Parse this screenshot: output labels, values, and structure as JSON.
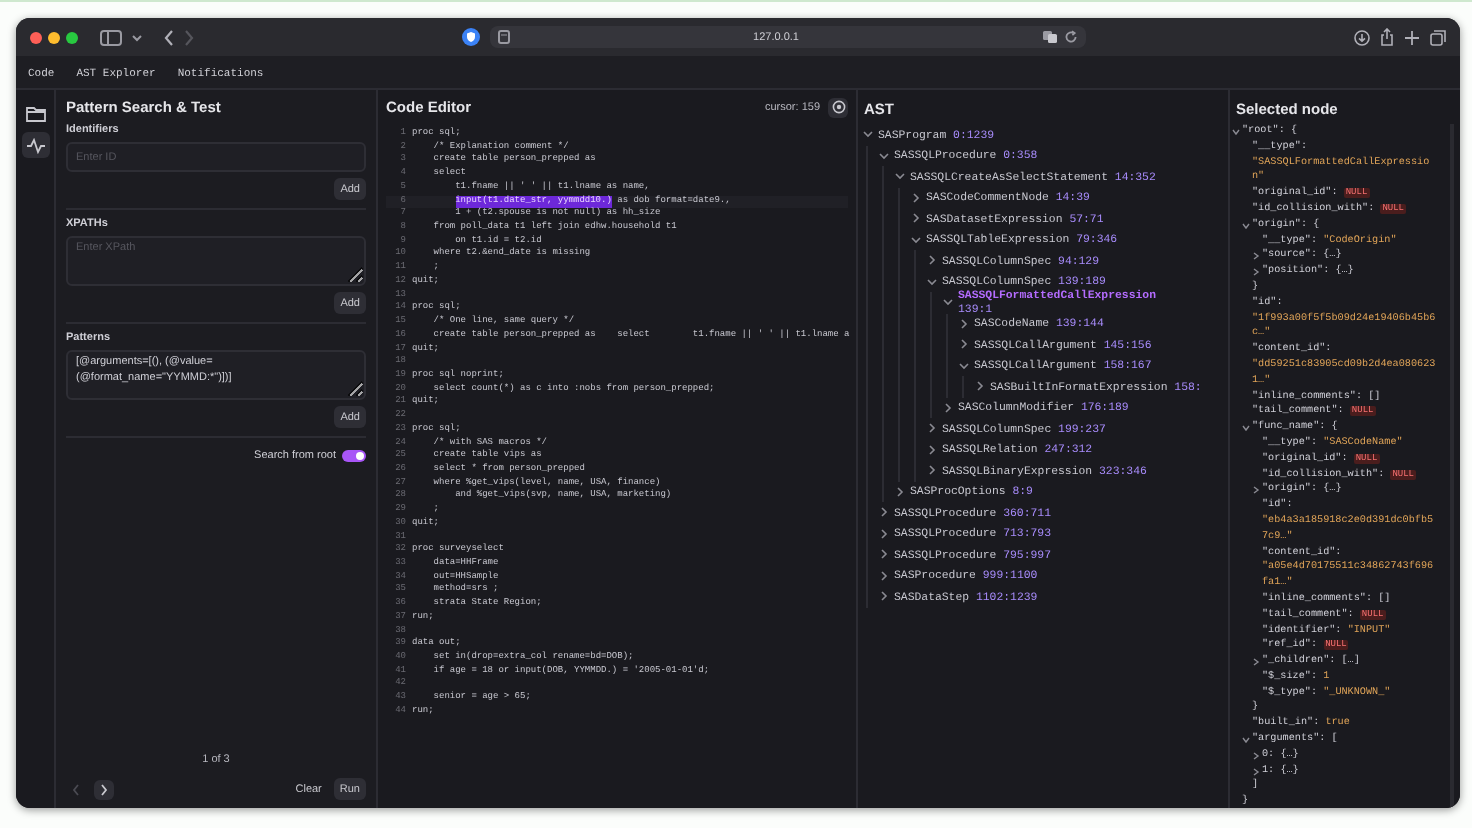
{
  "browser": {
    "url": "127.0.0.1"
  },
  "menu": [
    "Code",
    "AST Explorer",
    "Notifications"
  ],
  "rail": [
    {
      "kind": "folder",
      "selected": false
    },
    {
      "kind": "activity",
      "selected": true
    }
  ],
  "search": {
    "title": "Pattern Search & Test",
    "sections": [
      {
        "label": "Identifiers",
        "kind": "input",
        "placeholder": "Enter ID",
        "button": "Add"
      },
      {
        "label": "XPATHs",
        "kind": "textarea",
        "placeholder": "Enter XPath",
        "button": "Add"
      },
      {
        "label": "Patterns",
        "kind": "textarea",
        "value": "[@arguments=[(), (@value=(@format_name=\"YYMMD:*\")])]",
        "button": "Add"
      }
    ],
    "from_root": {
      "label": "Search from root",
      "on": true
    },
    "pager": "1 of 3",
    "prev_disabled": true,
    "next_disabled": false,
    "clear": "Clear",
    "run": "Run"
  },
  "editor": {
    "title": "Code Editor",
    "cursor": "cursor: 159",
    "lines": [
      {
        "n": "1",
        "text": "proc sql;"
      },
      {
        "n": "2",
        "text": "    /* Explanation comment */"
      },
      {
        "n": "3",
        "text": "    create table person_prepped as"
      },
      {
        "n": "4",
        "text": "    select"
      },
      {
        "n": "5",
        "text": "        t1.fname || ' ' || t1.lname as name,"
      },
      {
        "n": "6",
        "highlight": "input(t1.date_str, yymmdd10.)",
        "after": " as dob format=date9.,"
      },
      {
        "n": "7",
        "text": "        1 + (t2.spouse is not null) as hh_size"
      },
      {
        "n": "8",
        "text": "    from poll_data t1 left join edhw.household t1"
      },
      {
        "n": "9",
        "text": "        on t1.id = t2.id"
      },
      {
        "n": "10",
        "text": "    where t2.&end_date is missing"
      },
      {
        "n": "11",
        "text": "    ;"
      },
      {
        "n": "12",
        "text": "quit;"
      },
      {
        "n": "13"
      },
      {
        "n": "14",
        "text": "proc sql;"
      },
      {
        "n": "15",
        "text": "    /* One line, same query */"
      },
      {
        "n": "16",
        "text": "    create table person_prepped as    select        t1.fname || ' ' || t1.lname a"
      },
      {
        "n": "17",
        "text": "quit;"
      },
      {
        "n": "18"
      },
      {
        "n": "19",
        "text": "proc sql noprint;"
      },
      {
        "n": "20",
        "text": "    select count(*) as c into :nobs from person_prepped;"
      },
      {
        "n": "21",
        "text": "quit;"
      },
      {
        "n": "22"
      },
      {
        "n": "23",
        "text": "proc sql;"
      },
      {
        "n": "24",
        "text": "    /* with SAS macros */"
      },
      {
        "n": "25",
        "text": "    create table vips as"
      },
      {
        "n": "26",
        "text": "    select * from person_prepped"
      },
      {
        "n": "27",
        "text": "    where %get_vips(level, name, USA, finance)"
      },
      {
        "n": "28",
        "text": "        and %get_vips(svp, name, USA, marketing)"
      },
      {
        "n": "29",
        "text": "    ;"
      },
      {
        "n": "30",
        "text": "quit;"
      },
      {
        "n": "31"
      },
      {
        "n": "32",
        "text": "proc surveyselect"
      },
      {
        "n": "33",
        "text": "    data=HHFrame"
      },
      {
        "n": "34",
        "text": "    out=HHSample"
      },
      {
        "n": "35",
        "text": "    method=srs ;"
      },
      {
        "n": "36",
        "text": "    strata State Region;"
      },
      {
        "n": "37",
        "text": "run;"
      },
      {
        "n": "38"
      },
      {
        "n": "39",
        "text": "data out;"
      },
      {
        "n": "40",
        "text": "    set in(drop=extra_col rename=bd=DOB);"
      },
      {
        "n": "41",
        "text": "    if age = 18 or input(DOB, YYMMDD.) = '2005-01-01'd;"
      },
      {
        "n": "42"
      },
      {
        "n": "43",
        "text": "    senior = age > 65;"
      },
      {
        "n": "44",
        "text": "run;"
      }
    ]
  },
  "ast": {
    "title": "AST",
    "nodes": [
      {
        "name": "SASProgram",
        "range": "0:1239",
        "expanded": true,
        "selected": false,
        "children": [
          {
            "name": "SASSQLProcedure",
            "range": "0:358",
            "expanded": true,
            "selected": false,
            "children": [
              {
                "name": "SASSQLCreateAsSelectStatement",
                "range": "14:352",
                "expanded": true,
                "selected": false,
                "children": [
                  {
                    "name": "SASCodeCommentNode",
                    "range": "14:39",
                    "expanded": false,
                    "selected": false
                  },
                  {
                    "name": "SASDatasetExpression",
                    "range": "57:71",
                    "expanded": false,
                    "selected": false
                  },
                  {
                    "name": "SASSQLTableExpression",
                    "range": "79:346",
                    "expanded": true,
                    "selected": false,
                    "children": [
                      {
                        "name": "SASSQLColumnSpec",
                        "range": "94:129",
                        "expanded": false,
                        "selected": false
                      },
                      {
                        "name": "SASSQLColumnSpec",
                        "range": "139:189",
                        "expanded": true,
                        "selected": false,
                        "children": [
                          {
                            "name": "SASSQLFormattedCallExpression",
                            "range": "139:1",
                            "expanded": true,
                            "selected": true,
                            "children": [
                              {
                                "name": "SASCodeName",
                                "range": "139:144",
                                "expanded": false,
                                "selected": false
                              },
                              {
                                "name": "SASSQLCallArgument",
                                "range": "145:156",
                                "expanded": false,
                                "selected": false
                              },
                              {
                                "name": "SASSQLCallArgument",
                                "range": "158:167",
                                "expanded": true,
                                "selected": false,
                                "children": [
                                  {
                                    "name": "SASBuiltInFormatExpression",
                                    "range": "158:",
                                    "expanded": false,
                                    "selected": false
                                  }
                                ]
                              }
                            ]
                          },
                          {
                            "name": "SASColumnModifier",
                            "range": "176:189",
                            "expanded": false,
                            "selected": false
                          }
                        ]
                      },
                      {
                        "name": "SASSQLColumnSpec",
                        "range": "199:237",
                        "expanded": false,
                        "selected": false
                      },
                      {
                        "name": "SASSQLRelation",
                        "range": "247:312",
                        "expanded": false,
                        "selected": false
                      },
                      {
                        "name": "SASSQLBinaryExpression",
                        "range": "323:346",
                        "expanded": false,
                        "selected": false
                      }
                    ]
                  }
                ]
              },
              {
                "name": "SASProcOptions",
                "range": "8:9",
                "expanded": false,
                "selected": false
              }
            ]
          },
          {
            "name": "SASSQLProcedure",
            "range": "360:711",
            "expanded": false,
            "selected": false
          },
          {
            "name": "SASSQLProcedure",
            "range": "713:793",
            "expanded": false,
            "selected": false
          },
          {
            "name": "SASSQLProcedure",
            "range": "795:997",
            "expanded": false,
            "selected": false
          },
          {
            "name": "SASProcedure",
            "range": "999:1100",
            "expanded": false,
            "selected": false
          },
          {
            "name": "SASDataStep",
            "range": "1102:1239",
            "expanded": false,
            "selected": false
          }
        ]
      }
    ]
  },
  "selected_node": {
    "title": "Selected node",
    "items": [
      {
        "key": "\"root\": {",
        "kind": "group",
        "expanded": true,
        "close": "}",
        "children": [
          {
            "key": "\"__type\":",
            "value": "\"SASSQLFormattedCallExpression\"",
            "kind": "block"
          },
          {
            "key": "\"original_id\":",
            "value": "NULL",
            "kind": "null"
          },
          {
            "key": "\"id_collision_with\":",
            "value": "NULL",
            "kind": "null"
          },
          {
            "key": "\"origin\": {",
            "kind": "group",
            "expanded": true,
            "close": "}",
            "children": [
              {
                "key": "\"__type\":",
                "value": "\"CodeOrigin\"",
                "kind": "string"
              },
              {
                "key": "\"source\":",
                "value": "{…}",
                "kind": "collapsed",
                "expanded": false
              },
              {
                "key": "\"position\":",
                "value": "{…}",
                "kind": "collapsed",
                "expanded": false
              }
            ]
          },
          {
            "key": "\"id\":",
            "value": "\"1f993a00f5f5b09d24e19406b45b6c…\"",
            "kind": "block"
          },
          {
            "key": "\"content_id\":",
            "value": "\"dd59251c83905cd09b2d4ea0806231…\"",
            "kind": "block"
          },
          {
            "key": "\"inline_comments\":",
            "value": "[]",
            "kind": "plain"
          },
          {
            "key": "\"tail_comment\":",
            "value": "NULL",
            "kind": "null"
          },
          {
            "key": "\"func_name\": {",
            "kind": "group",
            "expanded": true,
            "close": "}",
            "children": [
              {
                "key": "\"__type\":",
                "value": "\"SASCodeName\"",
                "kind": "string"
              },
              {
                "key": "\"original_id\":",
                "value": "NULL",
                "kind": "null"
              },
              {
                "key": "\"id_collision_with\":",
                "value": "NULL",
                "kind": "null"
              },
              {
                "key": "\"origin\":",
                "value": "{…}",
                "kind": "collapsed",
                "expanded": false
              },
              {
                "key": "\"id\":",
                "value": "\"eb4a3a185918c2e0d391dc0bfb57c9…\"",
                "kind": "block"
              },
              {
                "key": "\"content_id\":",
                "value": "\"a05e4d70175511c34862743f696fa1…\"",
                "kind": "block"
              },
              {
                "key": "\"inline_comments\":",
                "value": "[]",
                "kind": "plain"
              },
              {
                "key": "\"tail_comment\":",
                "value": "NULL",
                "kind": "null"
              },
              {
                "key": "\"identifier\":",
                "value": "\"INPUT\"",
                "kind": "string"
              },
              {
                "key": "\"ref_id\":",
                "value": "NULL",
                "kind": "null"
              },
              {
                "key": "\"_children\":",
                "value": "[…]",
                "kind": "collapsed",
                "expanded": false
              },
              {
                "key": "\"$_size\":",
                "value": "1",
                "kind": "literal"
              },
              {
                "key": "\"$_type\":",
                "value": "\"_UNKNOWN_\"",
                "kind": "string"
              }
            ]
          },
          {
            "key": "\"built_in\":",
            "value": "true",
            "kind": "literal"
          },
          {
            "key": "\"arguments\": [",
            "kind": "group",
            "expanded": true,
            "close": "]",
            "children": [
              {
                "key": "0:",
                "value": "{…}",
                "kind": "collapsed",
                "expanded": false
              },
              {
                "key": "1:",
                "value": "{…}",
                "kind": "collapsed",
                "expanded": false
              }
            ]
          }
        ]
      }
    ]
  }
}
